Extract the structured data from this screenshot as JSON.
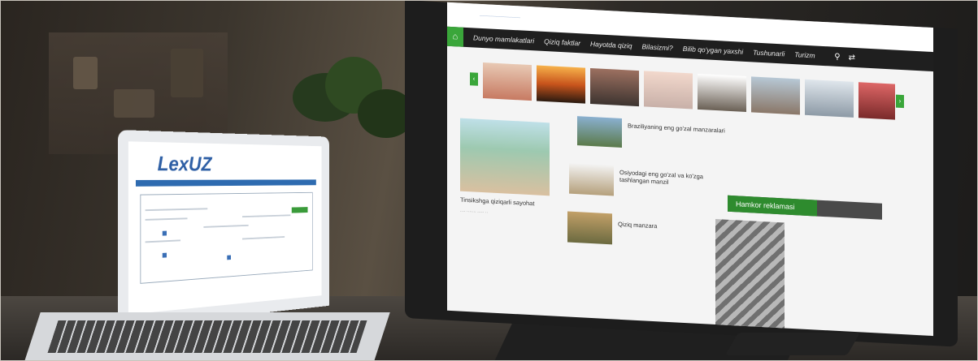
{
  "monitor": {
    "nav_items": [
      "Dunyo mamlakatlari",
      "Qiziq faktlar",
      "Hayotda qiziq",
      "Bilasizmi?",
      "Bilib qo'ygan yaxshi",
      "Tushunarli",
      "Turizm"
    ],
    "posts": [
      {
        "title": "Tinsikshga qiziqarli sayohat"
      },
      {
        "title": "Braziliyaning eng go'zal manzaralari"
      },
      {
        "title": "Osiyodagi eng go'zal va ko'zga tashlangan manzil"
      },
      {
        "title": "Qiziq manzara"
      }
    ],
    "partner_label": "Hamkor reklamasi"
  },
  "laptop": {
    "logo_text": "LexUZ"
  },
  "colors": {
    "nav_bg": "#1f1f1f",
    "accent_green": "#3aa63a",
    "logo_blue": "#2e5fa5"
  }
}
